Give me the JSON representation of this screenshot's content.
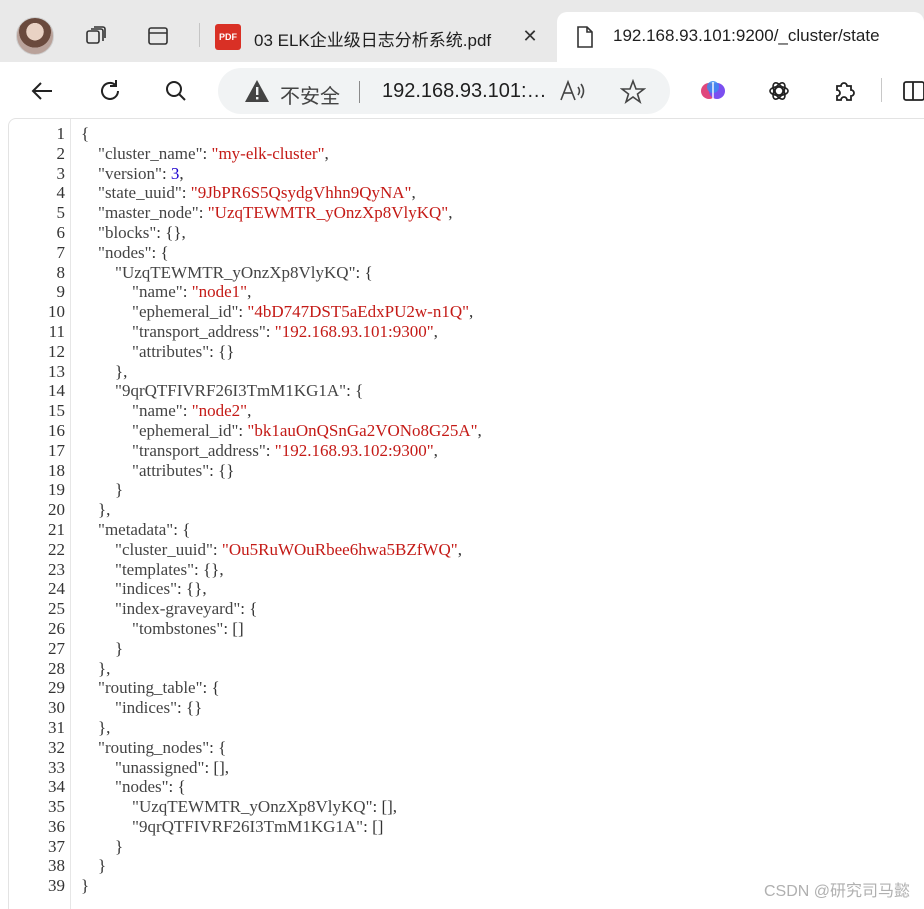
{
  "browser": {
    "tabs": [
      {
        "title": "03 ELK企业级日志分析系统.pdf",
        "icon": "pdf-icon",
        "badge": "PDF",
        "close": "✕"
      },
      {
        "title": "192.168.93.101:9200/_cluster/state",
        "icon": "document-icon",
        "close": "✕"
      }
    ],
    "toolbar": {
      "security_label": "不安全",
      "url": "192.168.93.101:9200/_cluster/state"
    }
  },
  "source_lines": [
    [
      "{"
    ],
    [
      "    ",
      {
        "k": "\"cluster_name\""
      },
      ": ",
      {
        "s": "\"my-elk-cluster\""
      },
      ","
    ],
    [
      "    ",
      {
        "k": "\"version\""
      },
      ": ",
      {
        "n": "3"
      },
      ","
    ],
    [
      "    ",
      {
        "k": "\"state_uuid\""
      },
      ": ",
      {
        "s": "\"9JbPR6S5QsydgVhhn9QyNA\""
      },
      ","
    ],
    [
      "    ",
      {
        "k": "\"master_node\""
      },
      ": ",
      {
        "s": "\"UzqTEWMTR_yOnzXp8VlyKQ\""
      },
      ","
    ],
    [
      "    ",
      {
        "k": "\"blocks\""
      },
      ": {},"
    ],
    [
      "    ",
      {
        "k": "\"nodes\""
      },
      ": {"
    ],
    [
      "        ",
      {
        "k": "\"UzqTEWMTR_yOnzXp8VlyKQ\""
      },
      ": {"
    ],
    [
      "            ",
      {
        "k": "\"name\""
      },
      ": ",
      {
        "s": "\"node1\""
      },
      ","
    ],
    [
      "            ",
      {
        "k": "\"ephemeral_id\""
      },
      ": ",
      {
        "s": "\"4bD747DST5aEdxPU2w-n1Q\""
      },
      ","
    ],
    [
      "            ",
      {
        "k": "\"transport_address\""
      },
      ": ",
      {
        "s": "\"192.168.93.101:9300\""
      },
      ","
    ],
    [
      "            ",
      {
        "k": "\"attributes\""
      },
      ": {}"
    ],
    [
      "        },"
    ],
    [
      "        ",
      {
        "k": "\"9qrQTFIVRF26I3TmM1KG1A\""
      },
      ": {"
    ],
    [
      "            ",
      {
        "k": "\"name\""
      },
      ": ",
      {
        "s": "\"node2\""
      },
      ","
    ],
    [
      "            ",
      {
        "k": "\"ephemeral_id\""
      },
      ": ",
      {
        "s": "\"bk1auOnQSnGa2VONo8G25A\""
      },
      ","
    ],
    [
      "            ",
      {
        "k": "\"transport_address\""
      },
      ": ",
      {
        "s": "\"192.168.93.102:9300\""
      },
      ","
    ],
    [
      "            ",
      {
        "k": "\"attributes\""
      },
      ": {}"
    ],
    [
      "        }"
    ],
    [
      "    },"
    ],
    [
      "    ",
      {
        "k": "\"metadata\""
      },
      ": {"
    ],
    [
      "        ",
      {
        "k": "\"cluster_uuid\""
      },
      ": ",
      {
        "s": "\"Ou5RuWOuRbee6hwa5BZfWQ\""
      },
      ","
    ],
    [
      "        ",
      {
        "k": "\"templates\""
      },
      ": {},"
    ],
    [
      "        ",
      {
        "k": "\"indices\""
      },
      ": {},"
    ],
    [
      "        ",
      {
        "k": "\"index-graveyard\""
      },
      ": {"
    ],
    [
      "            ",
      {
        "k": "\"tombstones\""
      },
      ": []"
    ],
    [
      "        }"
    ],
    [
      "    },"
    ],
    [
      "    ",
      {
        "k": "\"routing_table\""
      },
      ": {"
    ],
    [
      "        ",
      {
        "k": "\"indices\""
      },
      ": {}"
    ],
    [
      "    },"
    ],
    [
      "    ",
      {
        "k": "\"routing_nodes\""
      },
      ": {"
    ],
    [
      "        ",
      {
        "k": "\"unassigned\""
      },
      ": [],"
    ],
    [
      "        ",
      {
        "k": "\"nodes\""
      },
      ": {"
    ],
    [
      "            ",
      {
        "k": "\"UzqTEWMTR_yOnzXp8VlyKQ\""
      },
      ": [],"
    ],
    [
      "            ",
      {
        "k": "\"9qrQTFIVRF26I3TmM1KG1A\""
      },
      ": []"
    ],
    [
      "        }"
    ],
    [
      "    }"
    ],
    [
      "}"
    ]
  ],
  "watermark": "CSDN @研究司马懿",
  "colors": {
    "string": "#c41a16",
    "number": "#1c00cf",
    "key": "#444444",
    "tabstrip_bg": "#e9e9e9"
  }
}
